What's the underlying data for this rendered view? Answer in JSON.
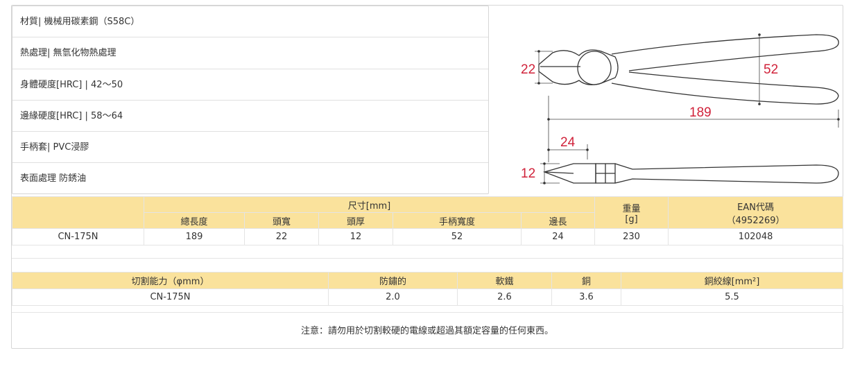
{
  "specs": [
    "材質| 機械用碳素鋼（S58C）",
    "熱處理| 無氫化物熱處理",
    "身體硬度[HRC] | 42～50",
    "邊緣硬度[HRC] | 58～64",
    "手柄套| PVC浸膠",
    "表面處理 防銹油"
  ],
  "drawing": {
    "dim_head_width": "22",
    "dim_handle_width": "52",
    "dim_total_length": "189",
    "dim_edge_length": "24",
    "dim_head_thickness": "12"
  },
  "colors": {
    "header_bg": "#fae29c",
    "dim_red": "#d0223a",
    "border": "#e4e4e4"
  },
  "table1": {
    "group_size": "尺寸[mm]",
    "weight": "重量",
    "weight_unit": "[g]",
    "ean": "EAN代碼",
    "ean_prefix": "（4952269）",
    "cols": [
      "總長度",
      "頭寬",
      "頭厚",
      "手柄寬度",
      "邊長"
    ],
    "row": {
      "model": "CN-175N",
      "total_length": "189",
      "head_width": "22",
      "head_thickness": "12",
      "handle_width": "52",
      "edge_length": "24",
      "weight": "230",
      "ean": "102048"
    }
  },
  "table2": {
    "headers": [
      "切割能力（φmm）",
      "防鏽的",
      "軟鐵",
      "銅",
      "銅絞線[mm²]"
    ],
    "row": {
      "model": "CN-175N",
      "v1": "2.0",
      "v2": "2.6",
      "v3": "3.6",
      "v4": "5.5"
    }
  },
  "note": "注意：請勿用於切割較硬的電線或超過其額定容量的任何東西。"
}
